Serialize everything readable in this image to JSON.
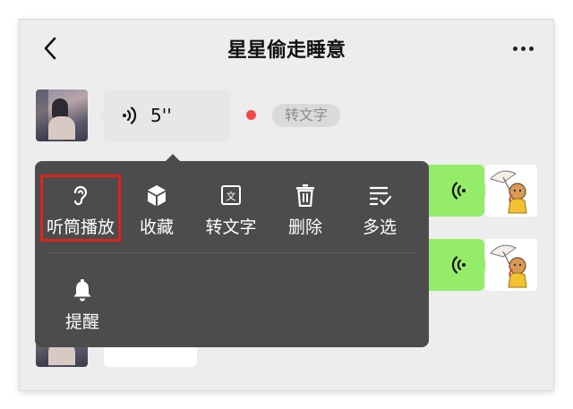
{
  "header": {
    "title": "星星偷走睡意",
    "back_icon": "chevron-left-icon",
    "more_icon": "more-dots-icon"
  },
  "messages": [
    {
      "side": "left",
      "type": "voice",
      "duration": "5''",
      "unread": true,
      "action_label": "转文字"
    },
    {
      "side": "right",
      "type": "voice"
    },
    {
      "side": "right",
      "type": "voice"
    },
    {
      "side": "left",
      "type": "voice"
    }
  ],
  "context_menu": {
    "items": [
      {
        "label": "听筒播放",
        "icon": "earpiece-icon",
        "highlighted": true
      },
      {
        "label": "收藏",
        "icon": "cube-icon"
      },
      {
        "label": "转文字",
        "icon": "text-doc-icon"
      },
      {
        "label": "删除",
        "icon": "trash-icon"
      },
      {
        "label": "多选",
        "icon": "multi-select-icon"
      },
      {
        "label": "提醒",
        "icon": "bell-icon"
      }
    ]
  },
  "colors": {
    "background": "#ededed",
    "menu": "#4c4c4c",
    "outgoing_bubble": "#95ec69",
    "unread_dot": "#f04a4a",
    "highlight": "#e0231b"
  }
}
